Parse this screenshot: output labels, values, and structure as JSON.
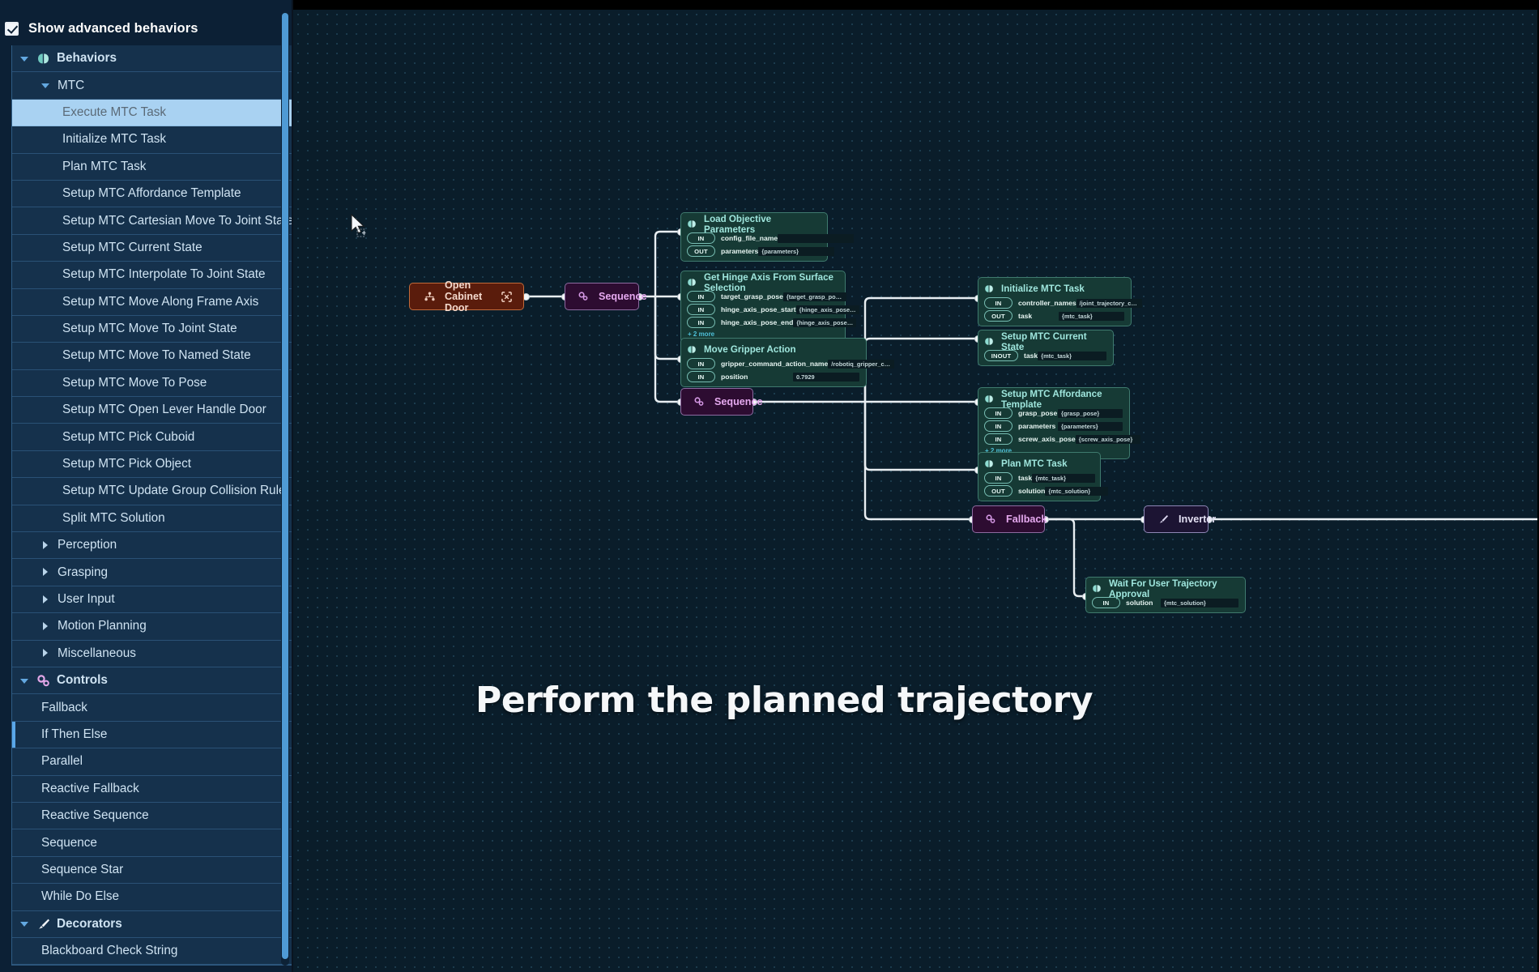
{
  "sidebar": {
    "checkbox": {
      "label": "Show advanced behaviors",
      "checked": true
    },
    "items": [
      {
        "label": "Behaviors",
        "kind": "header",
        "icon": "brain-icon",
        "caret": "down",
        "indent": 0,
        "color": "teal"
      },
      {
        "label": "MTC",
        "kind": "group",
        "icon": "none",
        "caret": "down",
        "indent": 1,
        "color": "teal"
      },
      {
        "label": "Execute MTC Task",
        "kind": "leaf",
        "indent": 2,
        "selected": true,
        "badge": "i"
      },
      {
        "label": "Initialize MTC Task",
        "kind": "leaf",
        "indent": 2
      },
      {
        "label": "Plan MTC Task",
        "kind": "leaf",
        "indent": 2
      },
      {
        "label": "Setup MTC Affordance Template",
        "kind": "leaf",
        "indent": 2
      },
      {
        "label": "Setup MTC Cartesian Move To Joint State",
        "kind": "leaf",
        "indent": 2
      },
      {
        "label": "Setup MTC Current State",
        "kind": "leaf",
        "indent": 2
      },
      {
        "label": "Setup MTC Interpolate To Joint State",
        "kind": "leaf",
        "indent": 2
      },
      {
        "label": "Setup MTC Move Along Frame Axis",
        "kind": "leaf",
        "indent": 2
      },
      {
        "label": "Setup MTC Move To Joint State",
        "kind": "leaf",
        "indent": 2
      },
      {
        "label": "Setup MTC Move To Named State",
        "kind": "leaf",
        "indent": 2
      },
      {
        "label": "Setup MTC Move To Pose",
        "kind": "leaf",
        "indent": 2
      },
      {
        "label": "Setup MTC Open Lever Handle Door",
        "kind": "leaf",
        "indent": 2
      },
      {
        "label": "Setup MTC Pick Cuboid",
        "kind": "leaf",
        "indent": 2
      },
      {
        "label": "Setup MTC Pick Object",
        "kind": "leaf",
        "indent": 2
      },
      {
        "label": "Setup MTC Update Group Collision Rule",
        "kind": "leaf",
        "indent": 2
      },
      {
        "label": "Split MTC Solution",
        "kind": "leaf",
        "indent": 2
      },
      {
        "label": "Perception",
        "kind": "group",
        "caret": "right",
        "indent": 1
      },
      {
        "label": "Grasping",
        "kind": "group",
        "caret": "right",
        "indent": 1
      },
      {
        "label": "User Input",
        "kind": "group",
        "caret": "right",
        "indent": 1
      },
      {
        "label": "Motion Planning",
        "kind": "group",
        "caret": "right",
        "indent": 1
      },
      {
        "label": "Miscellaneous",
        "kind": "group",
        "caret": "right",
        "indent": 1
      },
      {
        "label": "Controls",
        "kind": "header",
        "icon": "gears-icon",
        "caret": "down",
        "indent": 0,
        "color": "pink"
      },
      {
        "label": "Fallback",
        "kind": "leaf",
        "indent": 1,
        "color": "pink"
      },
      {
        "label": "If Then Else",
        "kind": "leaf",
        "indent": 1,
        "color": "pink",
        "activeLeft": true
      },
      {
        "label": "Parallel",
        "kind": "leaf",
        "indent": 1,
        "color": "pink"
      },
      {
        "label": "Reactive Fallback",
        "kind": "leaf",
        "indent": 1,
        "color": "pink"
      },
      {
        "label": "Reactive Sequence",
        "kind": "leaf",
        "indent": 1,
        "color": "pink"
      },
      {
        "label": "Sequence",
        "kind": "leaf",
        "indent": 1,
        "color": "pink"
      },
      {
        "label": "Sequence Star",
        "kind": "leaf",
        "indent": 1,
        "color": "pink"
      },
      {
        "label": "While Do Else",
        "kind": "leaf",
        "indent": 1,
        "color": "pink"
      },
      {
        "label": "Decorators",
        "kind": "header",
        "icon": "brush-icon",
        "caret": "down",
        "indent": 0,
        "color": "white"
      },
      {
        "label": "Blackboard Check String",
        "kind": "leaf",
        "indent": 1
      }
    ]
  },
  "canvas": {
    "caption": "Perform the planned trajectory",
    "nodes": [
      {
        "id": "open-cabinet-door",
        "type": "action",
        "title": "Open Cabinet Door",
        "icon": "subtree-icon",
        "badge_icon": "collapse-icon"
      },
      {
        "id": "sequence-1",
        "type": "control",
        "title": "Sequence",
        "icon": "gears-icon"
      },
      {
        "id": "sequence-2",
        "type": "control",
        "title": "Sequence",
        "icon": "gears-icon"
      },
      {
        "id": "fallback",
        "type": "control",
        "title": "Fallback",
        "icon": "gears-icon"
      },
      {
        "id": "inverter",
        "type": "decorator",
        "title": "Inverter",
        "icon": "brush-icon"
      },
      {
        "id": "load-objective-parameters",
        "type": "leaf",
        "title": "Load Objective Parameters",
        "icon": "brain-icon",
        "ports": [
          {
            "dir": "IN",
            "name": "config_file_name",
            "value": ""
          },
          {
            "dir": "OUT",
            "name": "parameters",
            "value": "{parameters}"
          }
        ]
      },
      {
        "id": "get-hinge-axis-from-surface-selection",
        "type": "leaf",
        "title": "Get Hinge Axis From Surface Selection",
        "icon": "brain-icon",
        "ports": [
          {
            "dir": "IN",
            "name": "target_grasp_pose",
            "value": "{target_grasp_pose}"
          },
          {
            "dir": "IN",
            "name": "hinge_axis_pose_start",
            "value": "{hinge_axis_pose_start}"
          },
          {
            "dir": "IN",
            "name": "hinge_axis_pose_end",
            "value": "{hinge_axis_pose_end}"
          }
        ],
        "more": "+ 2 more"
      },
      {
        "id": "move-gripper-action",
        "type": "leaf",
        "title": "Move Gripper Action",
        "icon": "brain-icon",
        "ports": [
          {
            "dir": "IN",
            "name": "gripper_command_action_name",
            "value": "/robotiq_gripper_controller"
          },
          {
            "dir": "IN",
            "name": "position",
            "value": "0.7929"
          }
        ]
      },
      {
        "id": "initialize-mtc-task",
        "type": "leaf",
        "title": "Initialize MTC Task",
        "icon": "brain-icon",
        "ports": [
          {
            "dir": "IN",
            "name": "controller_names",
            "value": "/joint_trajectory_controller"
          },
          {
            "dir": "OUT",
            "name": "task",
            "value": "{mtc_task}"
          }
        ]
      },
      {
        "id": "setup-mtc-current-state",
        "type": "leaf",
        "title": "Setup MTC Current State",
        "icon": "brain-icon",
        "ports": [
          {
            "dir": "INOUT",
            "name": "task",
            "value": "{mtc_task}"
          }
        ]
      },
      {
        "id": "setup-mtc-affordance-template",
        "type": "leaf",
        "title": "Setup MTC Affordance Template",
        "icon": "brain-icon",
        "ports": [
          {
            "dir": "IN",
            "name": "grasp_pose",
            "value": "{grasp_pose}"
          },
          {
            "dir": "IN",
            "name": "parameters",
            "value": "{parameters}"
          },
          {
            "dir": "IN",
            "name": "screw_axis_pose",
            "value": "{screw_axis_pose}"
          }
        ],
        "more": "+ 2 more"
      },
      {
        "id": "plan-mtc-task",
        "type": "leaf",
        "title": "Plan MTC Task",
        "icon": "brain-icon",
        "ports": [
          {
            "dir": "IN",
            "name": "task",
            "value": "{mtc_task}"
          },
          {
            "dir": "OUT",
            "name": "solution",
            "value": "{mtc_solution}"
          }
        ]
      },
      {
        "id": "wait-for-user-trajectory-approval",
        "type": "leaf",
        "title": "Wait For User Trajectory Approval",
        "icon": "brain-icon",
        "ports": [
          {
            "dir": "IN",
            "name": "solution",
            "value": "{mtc_solution}"
          }
        ]
      }
    ]
  },
  "colors": {
    "canvas_bg": "#0a1d2a",
    "sidebar_bg": "#0c2035",
    "leaf_node": "#163a35",
    "control_node": "#2d0c31",
    "action_node": "#5a1c0c",
    "decorator_node": "#1c1433",
    "selection": "#a9d2f2",
    "accent_pink": "#e3a7e8",
    "accent_teal": "#7fd8cf",
    "wire": "#e8eef2"
  }
}
